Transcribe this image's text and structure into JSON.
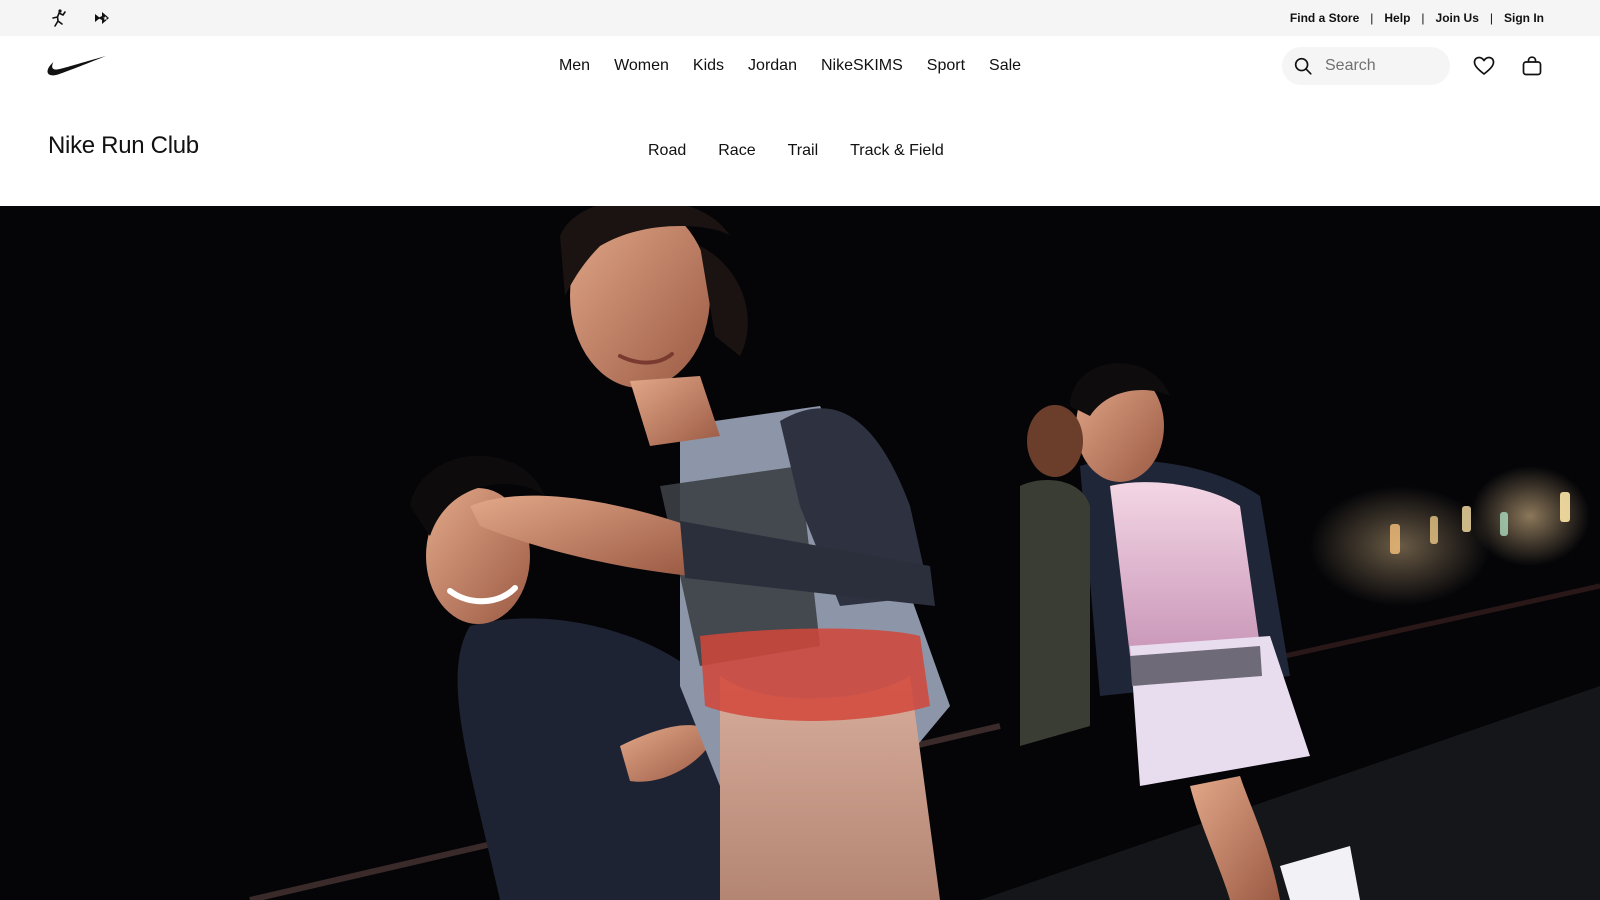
{
  "utility": {
    "links": [
      {
        "label": "Find a Store"
      },
      {
        "label": "Help"
      },
      {
        "label": "Join Us"
      },
      {
        "label": "Sign In"
      }
    ],
    "separator": "|"
  },
  "header": {
    "nav": [
      {
        "label": "Men"
      },
      {
        "label": "Women"
      },
      {
        "label": "Kids"
      },
      {
        "label": "Jordan"
      },
      {
        "label": "NikeSKIMS"
      },
      {
        "label": "Sport"
      },
      {
        "label": "Sale"
      }
    ],
    "search": {
      "placeholder": "Search"
    }
  },
  "sub_header": {
    "title": "Nike Run Club",
    "nav": [
      {
        "label": "Road"
      },
      {
        "label": "Race"
      },
      {
        "label": "Trail"
      },
      {
        "label": "Track & Field"
      }
    ]
  },
  "hero": {
    "image_subject": "runners at night"
  },
  "icons": {
    "jordan": "jumpman-icon",
    "converse": "converse-icon",
    "brand": "nike-swoosh-logo",
    "search": "search-icon",
    "favorites": "heart-icon",
    "bag": "bag-icon"
  },
  "colors": {
    "utility_bg": "#f5f5f5",
    "text": "#111111",
    "hero_bg": "#050508"
  }
}
